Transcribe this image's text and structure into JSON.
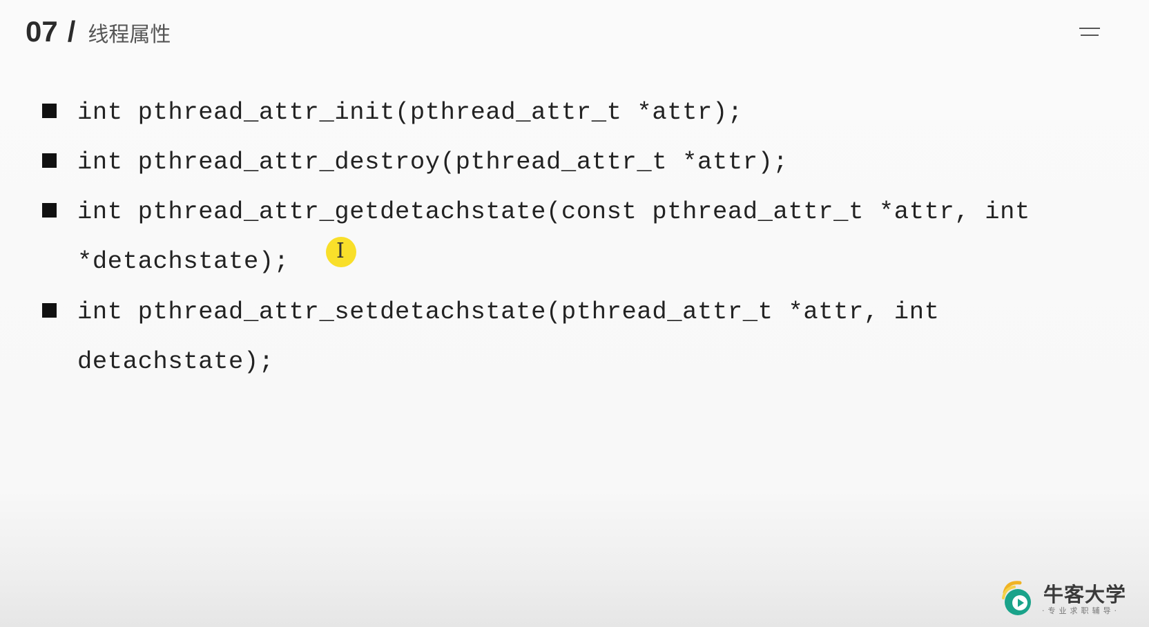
{
  "header": {
    "number": "07",
    "slash": "/",
    "title": "线程属性"
  },
  "items": [
    {
      "lines": [
        "int pthread_attr_init(pthread_attr_t *attr);"
      ]
    },
    {
      "lines": [
        "int pthread_attr_destroy(pthread_attr_t *attr);"
      ]
    },
    {
      "lines": [
        "int pthread_attr_getdetachstate(const pthread_attr_t *attr, int",
        "*detachstate);"
      ]
    },
    {
      "lines": [
        "int pthread_attr_setdetachstate(pthread_attr_t *attr, int",
        "detachstate);"
      ]
    }
  ],
  "cursor": {
    "glyph": "I",
    "highlight_color": "#f9df2a"
  },
  "logo": {
    "name": "牛客大学",
    "tagline": "·专业求职辅导·"
  },
  "icons": {
    "menu": "menu-icon",
    "bullet": "square-bullet-icon",
    "logo_mark": "niuke-logo-icon"
  }
}
